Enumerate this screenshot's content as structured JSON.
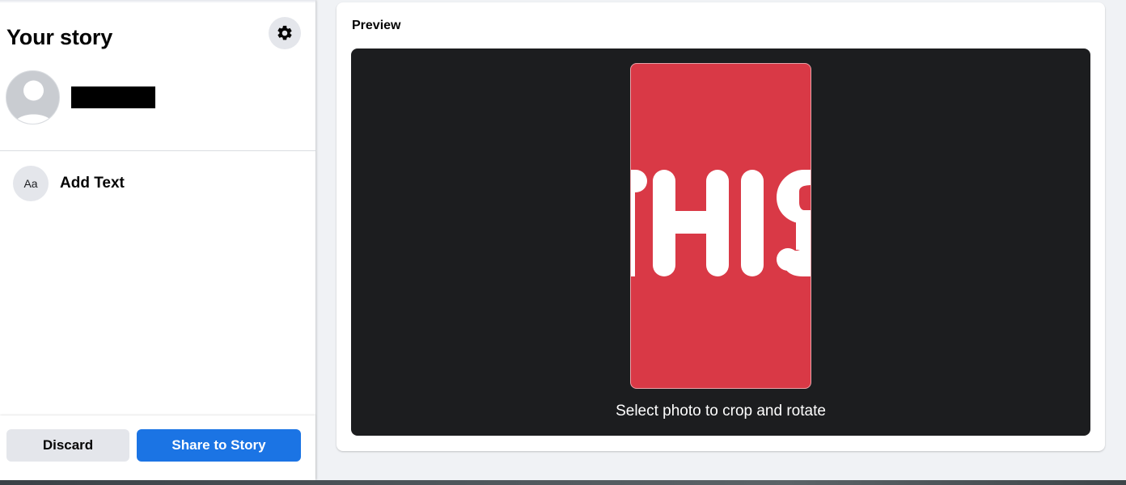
{
  "sidebar": {
    "title": "Your story",
    "settings_icon": "gear-icon",
    "avatar_icon": "default-avatar-icon",
    "tools": [
      {
        "icon_text": "Aa",
        "label": "Add Text"
      }
    ],
    "buttons": {
      "discard": "Discard",
      "share": "Share to Story"
    }
  },
  "preview": {
    "label": "Preview",
    "story_text": "THIS",
    "hint": "Select photo to crop and rotate"
  },
  "colors": {
    "accent": "#1b74e4",
    "story_background": "#d93946",
    "canvas_background": "#1c1d1f"
  }
}
